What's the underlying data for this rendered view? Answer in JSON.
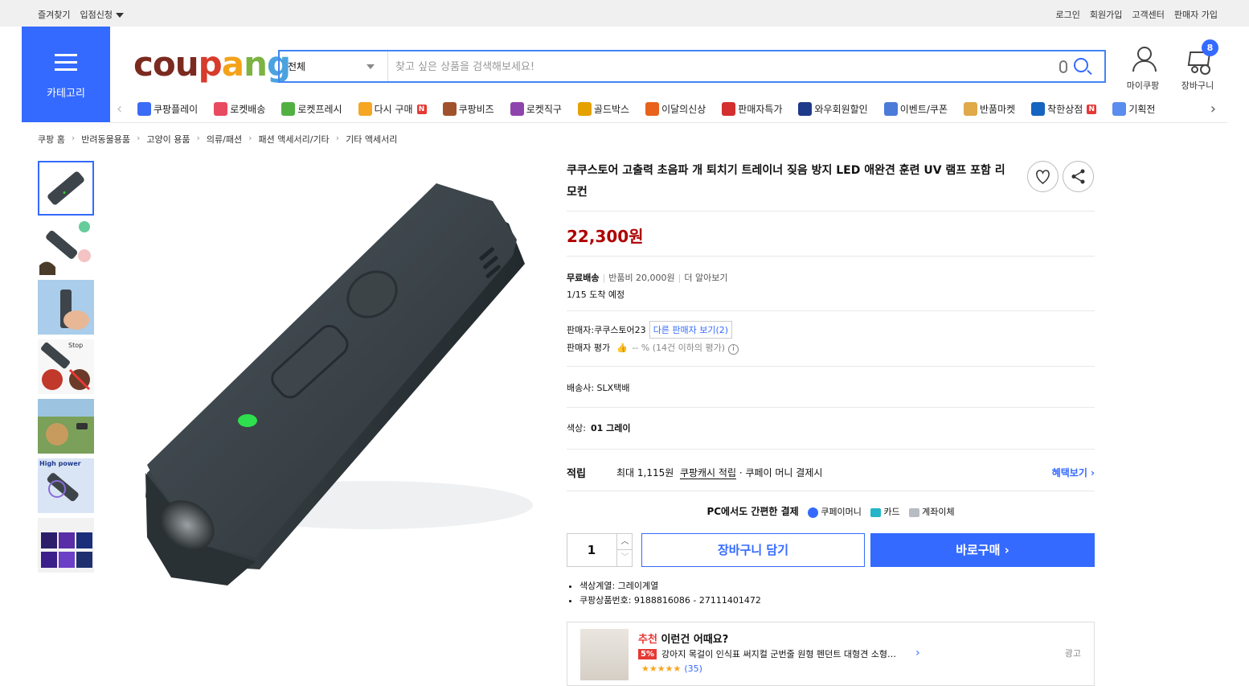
{
  "topbar": {
    "left": [
      "즐겨찾기",
      "입점신청"
    ],
    "right": [
      "로그인",
      "회원가입",
      "고객센터",
      "판매자 가입"
    ]
  },
  "category_label": "카테고리",
  "logo_letters": [
    "cou",
    "p",
    "a",
    "n",
    "g"
  ],
  "search": {
    "scope": "전체",
    "placeholder": "찾고 싶은 상품을 검색해보세요!"
  },
  "account": {
    "my_label": "마이쿠팡",
    "cart_label": "장바구니",
    "cart_count": "8"
  },
  "nav_items": [
    {
      "label": "쿠팡플레이",
      "color": "#3b6cf6",
      "new": false
    },
    {
      "label": "로켓배송",
      "color": "#e84a5f",
      "new": false
    },
    {
      "label": "로켓프레시",
      "color": "#52b043",
      "new": false
    },
    {
      "label": "다시 구매",
      "color": "#f5a623",
      "new": true
    },
    {
      "label": "쿠팡비즈",
      "color": "#a0522d",
      "new": false
    },
    {
      "label": "로켓직구",
      "color": "#8e44ad",
      "new": false
    },
    {
      "label": "골드박스",
      "color": "#e5a100",
      "new": false
    },
    {
      "label": "이달의신상",
      "color": "#e8621c",
      "new": false
    },
    {
      "label": "판매자특가",
      "color": "#d32f2f",
      "new": false
    },
    {
      "label": "와우회원할인",
      "color": "#1e3a8a",
      "new": false
    },
    {
      "label": "이벤트/쿠폰",
      "color": "#4a7bd8",
      "new": false
    },
    {
      "label": "반품마켓",
      "color": "#e0a94a",
      "new": false
    },
    {
      "label": "착한상점",
      "color": "#1565c0",
      "new": true
    },
    {
      "label": "기획전",
      "color": "#5b8def",
      "new": false
    }
  ],
  "breadcrumb": [
    "쿠팡 홈",
    "반려동물용품",
    "고양이 용품",
    "의류/패션",
    "패션 액세서리/기타",
    "기타 액세서리"
  ],
  "product": {
    "title": "쿠쿠스토어 고출력 초음파 개 퇴치기 트레이너 짖음 방지 LED 애완견 훈련 UV 램프 포함 리모컨",
    "price": "22,300원",
    "free_ship": "무료배송",
    "return_fee": "반품비 20,000원",
    "more": "더 알아보기",
    "eta": "1/15 도착 예정",
    "seller_label": "판매자:",
    "seller_name": "쿠쿠스토어23",
    "other_sellers": "다른 판매자 보기(2)",
    "rating_label": "판매자 평가",
    "rating_value": "-- % (14건 이하의 평가)",
    "carrier": "배송사:  SLX택배",
    "color_label": "색상:",
    "color_value": "01 그레이",
    "reward_head": "적립",
    "reward_max": "최대 1,115원",
    "reward_link": "쿠팡캐시 적립",
    "reward_tail": "· 쿠페이 머니 결제시",
    "reward_more": "혜택보기 ›",
    "pay_head": "PC에서도 간편한 결제",
    "pay_methods": [
      "쿠페이머니",
      "카드",
      "계좌이체"
    ],
    "qty": "1",
    "cart_btn": "장바구니 담기",
    "buy_btn": "바로구매 ›",
    "specs": [
      "색상계열: 그레이계열",
      "쿠팡상품번호: 9188816086 - 27111401472"
    ]
  },
  "recommend": {
    "head_red": "추천",
    "head_rest": " 이런건 어때요?",
    "pct": "5%",
    "name": "강아지 목걸이 인식표 써지컬 군번줄 원형 펜던트 대형견 소형…",
    "stars": "★★★★★",
    "count": "(35)",
    "ad": "광고"
  }
}
